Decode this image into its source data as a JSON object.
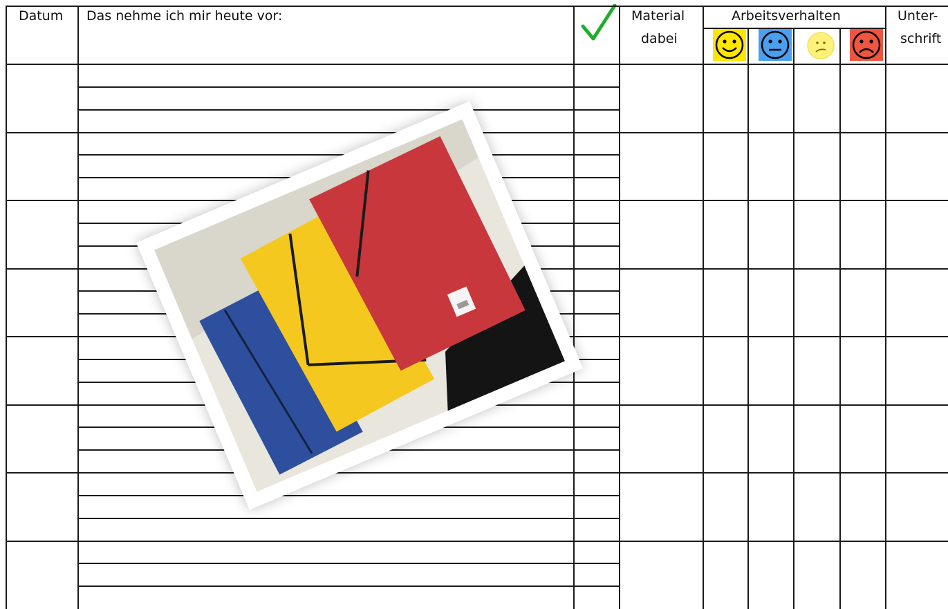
{
  "table": {
    "headers": {
      "date": "Datum",
      "plan": "Das nehme ich mir heute vor:",
      "material_line1": "Material",
      "material_line2": "dabei",
      "behavior": "Arbeitsverhalten",
      "signature_line1": "Unter-",
      "signature_line2": "schrift"
    },
    "check_icon": "checkmark-icon",
    "behavior_ratings": [
      {
        "icon": "smiley-happy-icon",
        "color": "#ffe600"
      },
      {
        "icon": "smiley-neutral-icon",
        "color": "#4a9ff0"
      },
      {
        "icon": "smiley-unsure-icon",
        "color": "#fff27a"
      },
      {
        "icon": "smiley-sad-icon",
        "color": "#f0553f"
      }
    ],
    "rows": 8
  },
  "photo": {
    "subject": "folders-photo",
    "folder_colors": [
      "#2d4f9e",
      "#f5c81f",
      "#c8373c"
    ]
  }
}
